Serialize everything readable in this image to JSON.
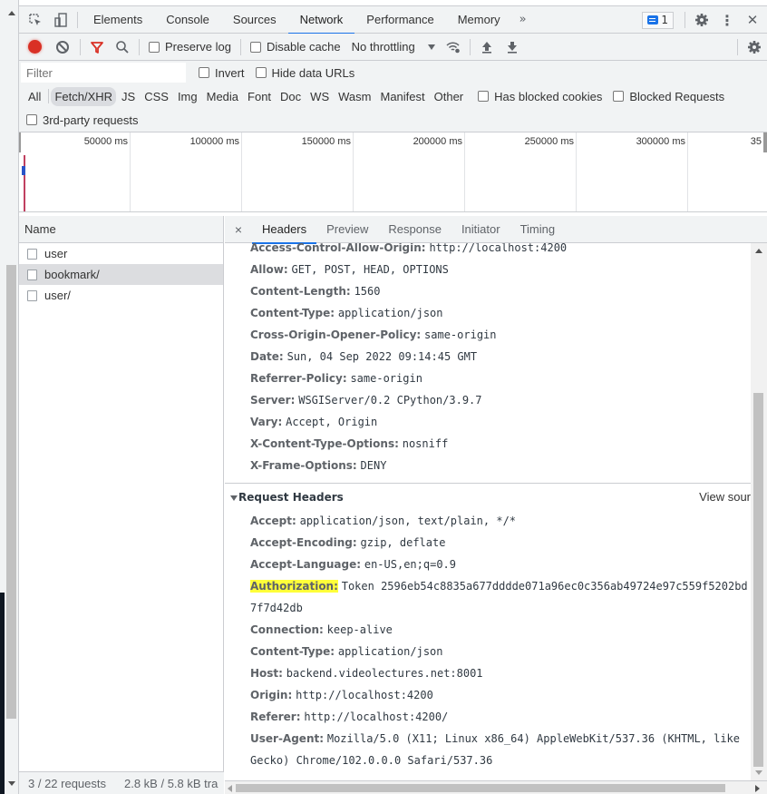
{
  "devtools": {
    "main_tabs": [
      {
        "label": "Elements",
        "active": false
      },
      {
        "label": "Console",
        "active": false
      },
      {
        "label": "Sources",
        "active": false
      },
      {
        "label": "Network",
        "active": true
      },
      {
        "label": "Performance",
        "active": false
      },
      {
        "label": "Memory",
        "active": false
      }
    ],
    "more_tabs_glyph": "»",
    "issues_count": "1",
    "close_glyph": "✕",
    "kebab_glyph": "⋮"
  },
  "network_toolbar": {
    "preserve_log": "Preserve log",
    "disable_cache": "Disable cache",
    "throttling": "No throttling"
  },
  "filter_bar": {
    "filter_placeholder": "Filter",
    "invert": "Invert",
    "hide_data_urls": "Hide data URLs",
    "types": [
      {
        "label": "All",
        "active": false
      },
      {
        "label": "Fetch/XHR",
        "active": true
      },
      {
        "label": "JS",
        "active": false
      },
      {
        "label": "CSS",
        "active": false
      },
      {
        "label": "Img",
        "active": false
      },
      {
        "label": "Media",
        "active": false
      },
      {
        "label": "Font",
        "active": false
      },
      {
        "label": "Doc",
        "active": false
      },
      {
        "label": "WS",
        "active": false
      },
      {
        "label": "Wasm",
        "active": false
      },
      {
        "label": "Manifest",
        "active": false
      },
      {
        "label": "Other",
        "active": false
      }
    ],
    "has_blocked_cookies": "Has blocked cookies",
    "blocked_requests": "Blocked Requests",
    "third_party": "3rd-party requests"
  },
  "overview": {
    "ticks": [
      "50000 ms",
      "100000 ms",
      "150000 ms",
      "200000 ms",
      "250000 ms",
      "300000 ms",
      "35"
    ]
  },
  "request_list": {
    "header": "Name",
    "rows": [
      {
        "name": "user",
        "selected": false
      },
      {
        "name": "bookmark/",
        "selected": true
      },
      {
        "name": "user/",
        "selected": false
      }
    ],
    "footer": {
      "requests": "3 / 22 requests",
      "transferred": "2.8 kB / 5.8 kB tra"
    }
  },
  "details": {
    "close_glyph": "×",
    "tabs": [
      {
        "label": "Headers",
        "active": true
      },
      {
        "label": "Preview",
        "active": false
      },
      {
        "label": "Response",
        "active": false
      },
      {
        "label": "Initiator",
        "active": false
      },
      {
        "label": "Timing",
        "active": false
      }
    ],
    "response_headers": [
      {
        "key": "Access-Control-Allow-Origin:",
        "value": "http://localhost:4200"
      },
      {
        "key": "Allow:",
        "value": "GET, POST, HEAD, OPTIONS"
      },
      {
        "key": "Content-Length:",
        "value": "1560"
      },
      {
        "key": "Content-Type:",
        "value": "application/json"
      },
      {
        "key": "Cross-Origin-Opener-Policy:",
        "value": "same-origin"
      },
      {
        "key": "Date:",
        "value": "Sun, 04 Sep 2022 09:14:45 GMT"
      },
      {
        "key": "Referrer-Policy:",
        "value": "same-origin"
      },
      {
        "key": "Server:",
        "value": "WSGIServer/0.2 CPython/3.9.7"
      },
      {
        "key": "Vary:",
        "value": "Accept, Origin"
      },
      {
        "key": "X-Content-Type-Options:",
        "value": "nosniff"
      },
      {
        "key": "X-Frame-Options:",
        "value": "DENY"
      }
    ],
    "request_section_title": "Request Headers",
    "view_source": "View sour",
    "request_headers": [
      {
        "key": "Accept:",
        "value": "application/json, text/plain, */*"
      },
      {
        "key": "Accept-Encoding:",
        "value": "gzip, deflate"
      },
      {
        "key": "Accept-Language:",
        "value": "en-US,en;q=0.9"
      },
      {
        "key": "Authorization:",
        "value": "Token 2596eb54c8835a677dddde071a96ec0c356ab49724e97c559f5202bd",
        "highlighted": true,
        "continuation": "7f7d42db"
      },
      {
        "key": "Connection:",
        "value": "keep-alive"
      },
      {
        "key": "Content-Type:",
        "value": "application/json"
      },
      {
        "key": "Host:",
        "value": "backend.videolectures.net:8001"
      },
      {
        "key": "Origin:",
        "value": "http://localhost:4200"
      },
      {
        "key": "Referer:",
        "value": "http://localhost:4200/"
      },
      {
        "key": "User-Agent:",
        "value": "Mozilla/5.0 (X11; Linux x86_64) AppleWebKit/537.36 (KHTML, like",
        "continuation": "Gecko) Chrome/102.0.0.0 Safari/537.36"
      }
    ]
  },
  "colors": {
    "accent": "#1a73e8",
    "record": "#d93025",
    "highlight": "#ffff3a",
    "filter_icon": "#d93025"
  }
}
